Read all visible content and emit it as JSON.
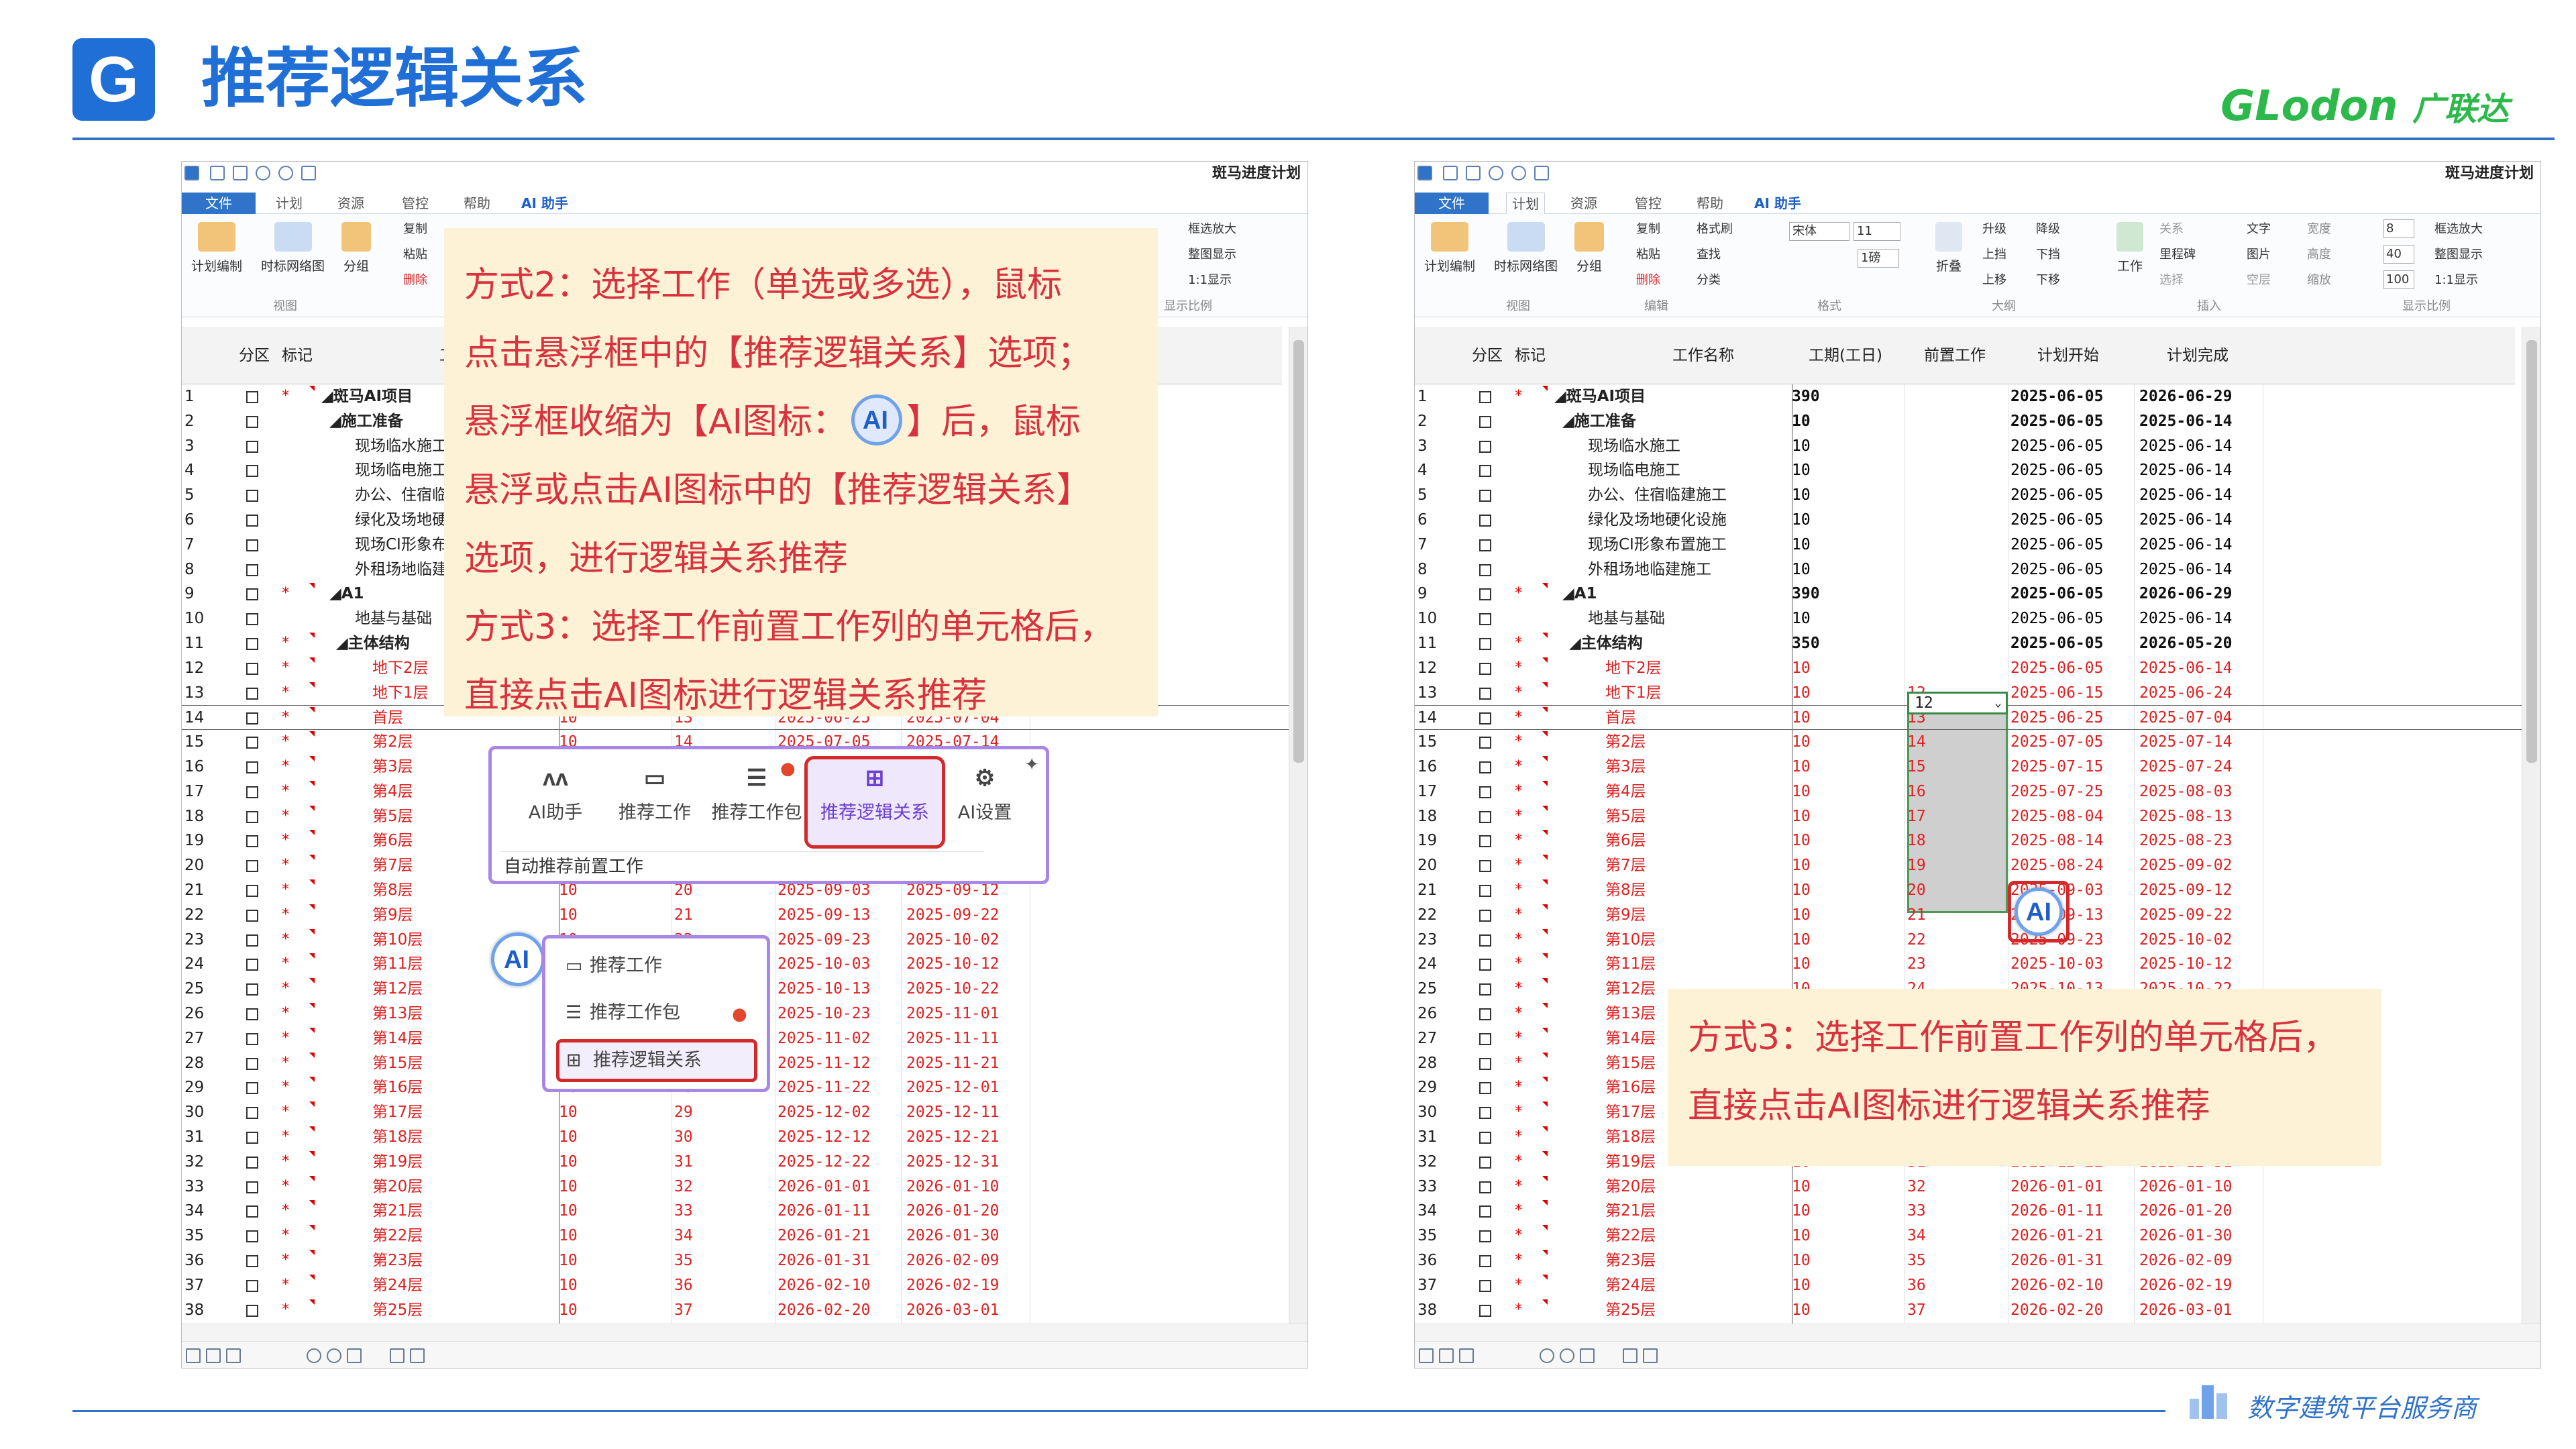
{
  "slide": {
    "logo_letter": "G",
    "title": "推荐逻辑关系",
    "brand": "GLodon",
    "brand_cn": "广联达",
    "slogan": "数字建筑平台服务商"
  },
  "app": {
    "doc_title": "斑马进度计划",
    "tabs": [
      "文件",
      "计划",
      "资源",
      "管控",
      "帮助",
      "AI 助手"
    ],
    "ribbon": {
      "btn_plan": "计划编制",
      "btn_net": "时标网络图",
      "btn_group": "分组",
      "grp_view": "视图",
      "copy": "复制",
      "format_brush": "格式刷",
      "paste": "粘贴",
      "find": "查找",
      "delete": "删除",
      "classify": "分类",
      "grp_edit": "编辑",
      "font": "宋体",
      "size": "11",
      "style": "1磅",
      "grp_format": "格式",
      "fold": "折叠",
      "up": "升级",
      "down": "降级",
      "move_up": "上移",
      "move_down": "下移",
      "goto_up": "上挡",
      "goto_down": "下挡",
      "grp_outline": "大纲",
      "work": "工作",
      "relation": "关系",
      "milestone": "里程碑",
      "select": "选择",
      "text": "文字",
      "picture": "图片",
      "blank": "空层",
      "grp_insert": "插入",
      "width": "宽度",
      "height": "高度",
      "zoom": "缩放",
      "w_val": "8",
      "h_val": "40",
      "z_val": "100",
      "frame_zoom": "框选放大",
      "whole": "整图显示",
      "one": "1:1显示",
      "grp_scale": "显示比例"
    },
    "headers": {
      "zone": "分区",
      "mark": "标记",
      "name": "工作名称",
      "dur": "工期(工日)",
      "pre": "前置工作",
      "start": "计划开始",
      "end": "计划完成"
    }
  },
  "rows": [
    [
      "1",
      "斑马AI项目",
      "390",
      "",
      "2025-06-05",
      "2026-06-29"
    ],
    [
      "2",
      "施工准备",
      "10",
      "",
      "2025-06-05",
      "2025-06-14"
    ],
    [
      "3",
      "现场临水施工",
      "10",
      "",
      "2025-06-05",
      "2025-06-14"
    ],
    [
      "4",
      "现场临电施工",
      "10",
      "",
      "2025-06-05",
      "2025-06-14"
    ],
    [
      "5",
      "办公、住宿临建施工",
      "10",
      "",
      "2025-06-05",
      "2025-06-14"
    ],
    [
      "6",
      "绿化及场地硬化设施",
      "10",
      "",
      "2025-06-05",
      "2025-06-14"
    ],
    [
      "7",
      "现场CI形象布置施工",
      "10",
      "",
      "2025-06-05",
      "2025-06-14"
    ],
    [
      "8",
      "外租场地临建施工",
      "10",
      "",
      "2025-06-05",
      "2025-06-14"
    ],
    [
      "9",
      "A1",
      "390",
      "",
      "2025-06-05",
      "2026-06-29"
    ],
    [
      "10",
      "地基与基础",
      "10",
      "",
      "2025-06-05",
      "2025-06-14"
    ],
    [
      "11",
      "主体结构",
      "350",
      "",
      "2025-06-05",
      "2026-05-20"
    ],
    [
      "12",
      "地下2层",
      "10",
      "",
      "2025-06-05",
      "2025-06-14"
    ],
    [
      "13",
      "地下1层",
      "10",
      "12",
      "2025-06-15",
      "2025-06-24"
    ],
    [
      "14",
      "首层",
      "10",
      "13",
      "2025-06-25",
      "2025-07-04"
    ],
    [
      "15",
      "第2层",
      "10",
      "14",
      "2025-07-05",
      "2025-07-14"
    ],
    [
      "16",
      "第3层",
      "10",
      "15",
      "2025-07-15",
      "2025-07-24"
    ],
    [
      "17",
      "第4层",
      "10",
      "16",
      "2025-07-25",
      "2025-08-03"
    ],
    [
      "18",
      "第5层",
      "10",
      "17",
      "2025-08-04",
      "2025-08-13"
    ],
    [
      "19",
      "第6层",
      "10",
      "18",
      "2025-08-14",
      "2025-08-23"
    ],
    [
      "20",
      "第7层",
      "10",
      "19",
      "2025-08-24",
      "2025-09-02"
    ],
    [
      "21",
      "第8层",
      "10",
      "20",
      "2025-09-03",
      "2025-09-12"
    ],
    [
      "22",
      "第9层",
      "10",
      "21",
      "2025-09-13",
      "2025-09-22"
    ],
    [
      "23",
      "第10层",
      "10",
      "22",
      "2025-09-23",
      "2025-10-02"
    ],
    [
      "24",
      "第11层",
      "10",
      "23",
      "2025-10-03",
      "2025-10-12"
    ],
    [
      "25",
      "第12层",
      "10",
      "24",
      "2025-10-13",
      "2025-10-22"
    ],
    [
      "26",
      "第13层",
      "10",
      "25",
      "2025-10-23",
      "2025-11-01"
    ],
    [
      "27",
      "第14层",
      "10",
      "26",
      "2025-11-02",
      "2025-11-11"
    ],
    [
      "28",
      "第15层",
      "10",
      "27",
      "2025-11-12",
      "2025-11-21"
    ],
    [
      "29",
      "第16层",
      "10",
      "28",
      "2025-11-22",
      "2025-12-01"
    ],
    [
      "30",
      "第17层",
      "10",
      "29",
      "2025-12-02",
      "2025-12-11"
    ],
    [
      "31",
      "第18层",
      "10",
      "30",
      "2025-12-12",
      "2025-12-21"
    ],
    [
      "32",
      "第19层",
      "10",
      "31",
      "2025-12-22",
      "2025-12-31"
    ],
    [
      "33",
      "第20层",
      "10",
      "32",
      "2026-01-01",
      "2026-01-10"
    ],
    [
      "34",
      "第21层",
      "10",
      "33",
      "2026-01-11",
      "2026-01-20"
    ],
    [
      "35",
      "第22层",
      "10",
      "34",
      "2026-01-21",
      "2026-01-30"
    ],
    [
      "36",
      "第23层",
      "10",
      "35",
      "2026-01-31",
      "2026-02-09"
    ],
    [
      "37",
      "第24层",
      "10",
      "36",
      "2026-02-10",
      "2026-02-19"
    ],
    [
      "38",
      "第25层",
      "10",
      "37",
      "2026-02-20",
      "2026-03-01"
    ]
  ],
  "note1": [
    "方式2：选择工作（单选或多选），鼠标",
    "点击悬浮框中的【推荐逻辑关系】选项；",
    "悬浮框收缩为【AI图标：",
    "】后，鼠标",
    "悬浮或点击AI图标中的【推荐逻辑关系】",
    "选项，进行逻辑关系推荐",
    "方式3：选择工作前置工作列的单元格后，",
    "直接点击AI图标进行逻辑关系推荐"
  ],
  "note2": [
    "方式3：选择工作前置工作列的单元格后，",
    "直接点击AI图标进行逻辑关系推荐"
  ],
  "popup": {
    "items": [
      "AI助手",
      "推荐工作",
      "推荐工作包",
      "推荐逻辑关系",
      "AI设置"
    ],
    "footer": "自动推荐前置工作",
    "ai_label": "AI"
  },
  "menu2": {
    "items": [
      "推荐工作",
      "推荐工作包",
      "推荐逻辑关系"
    ]
  },
  "cell_edit_value": "12",
  "colors": {
    "accent": "#1f6fd6",
    "brand": "#2db84b",
    "note_bg": "#fdf2d6",
    "note_text": "#d8323e",
    "highlight": "#d22a2a",
    "popup_border": "#a888e4"
  }
}
